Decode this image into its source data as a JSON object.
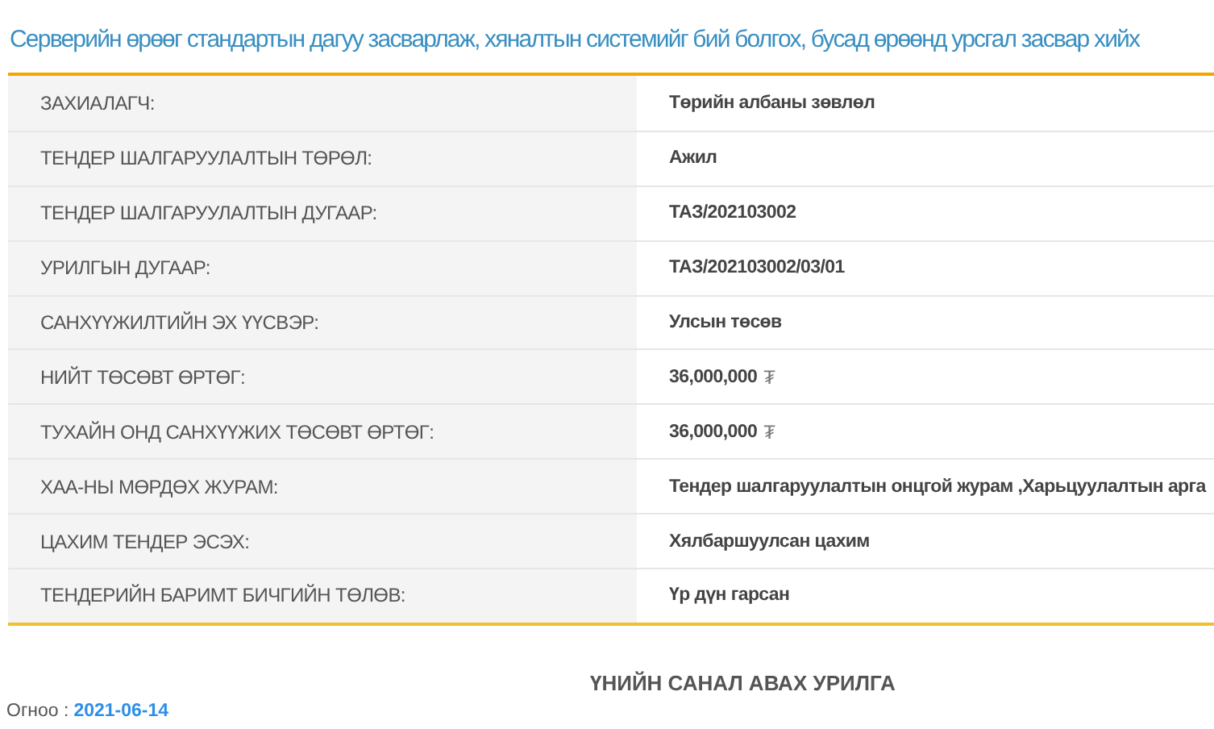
{
  "title": "Серверийн өрөөг стандартын дагуу засварлаж, хяналтын системийг бий болгох, бусад өрөөнд урсгал засвар хийх",
  "rows": [
    {
      "label": "ЗАХИАЛАГЧ:",
      "value": "Төрийн албаны зөвлөл"
    },
    {
      "label": "ТЕНДЕР ШАЛГАРУУЛАЛТЫН ТӨРӨЛ:",
      "value": "Ажил"
    },
    {
      "label": "ТЕНДЕР ШАЛГАРУУЛАЛТЫН ДУГААР:",
      "value": "ТАЗ/202103002"
    },
    {
      "label": "УРИЛГЫН ДУГААР:",
      "value": "ТАЗ/202103002/03/01"
    },
    {
      "label": "САНХҮҮЖИЛТИЙН ЭХ ҮҮСВЭР:",
      "value": "Улсын төсөв"
    },
    {
      "label": "НИЙТ ТӨСӨВТ ӨРТӨГ:",
      "value": "36,000,000",
      "unit": "₮"
    },
    {
      "label": "ТУХАЙН ОНД САНХҮҮЖИХ ТӨСӨВТ ӨРТӨГ:",
      "value": "36,000,000",
      "unit": "₮"
    },
    {
      "label": "ХАА-НЫ МӨРДӨХ ЖУРАМ:",
      "value": "Тендер шалгаруулалтын онцгой журам ,Харьцуулалтын арга"
    },
    {
      "label": "ЦАХИМ ТЕНДЕР ЭСЭХ:",
      "value": "Хялбаршуулсан цахим"
    },
    {
      "label": "ТЕНДЕРИЙН БАРИМТ БИЧГИЙН ТӨЛӨВ:",
      "value": "Үр дүн гарсан"
    }
  ],
  "heading": "ҮНИЙН САНАЛ АВАХ УРИЛГА",
  "date": {
    "label": "Огноо :",
    "value": "2021-06-14"
  }
}
